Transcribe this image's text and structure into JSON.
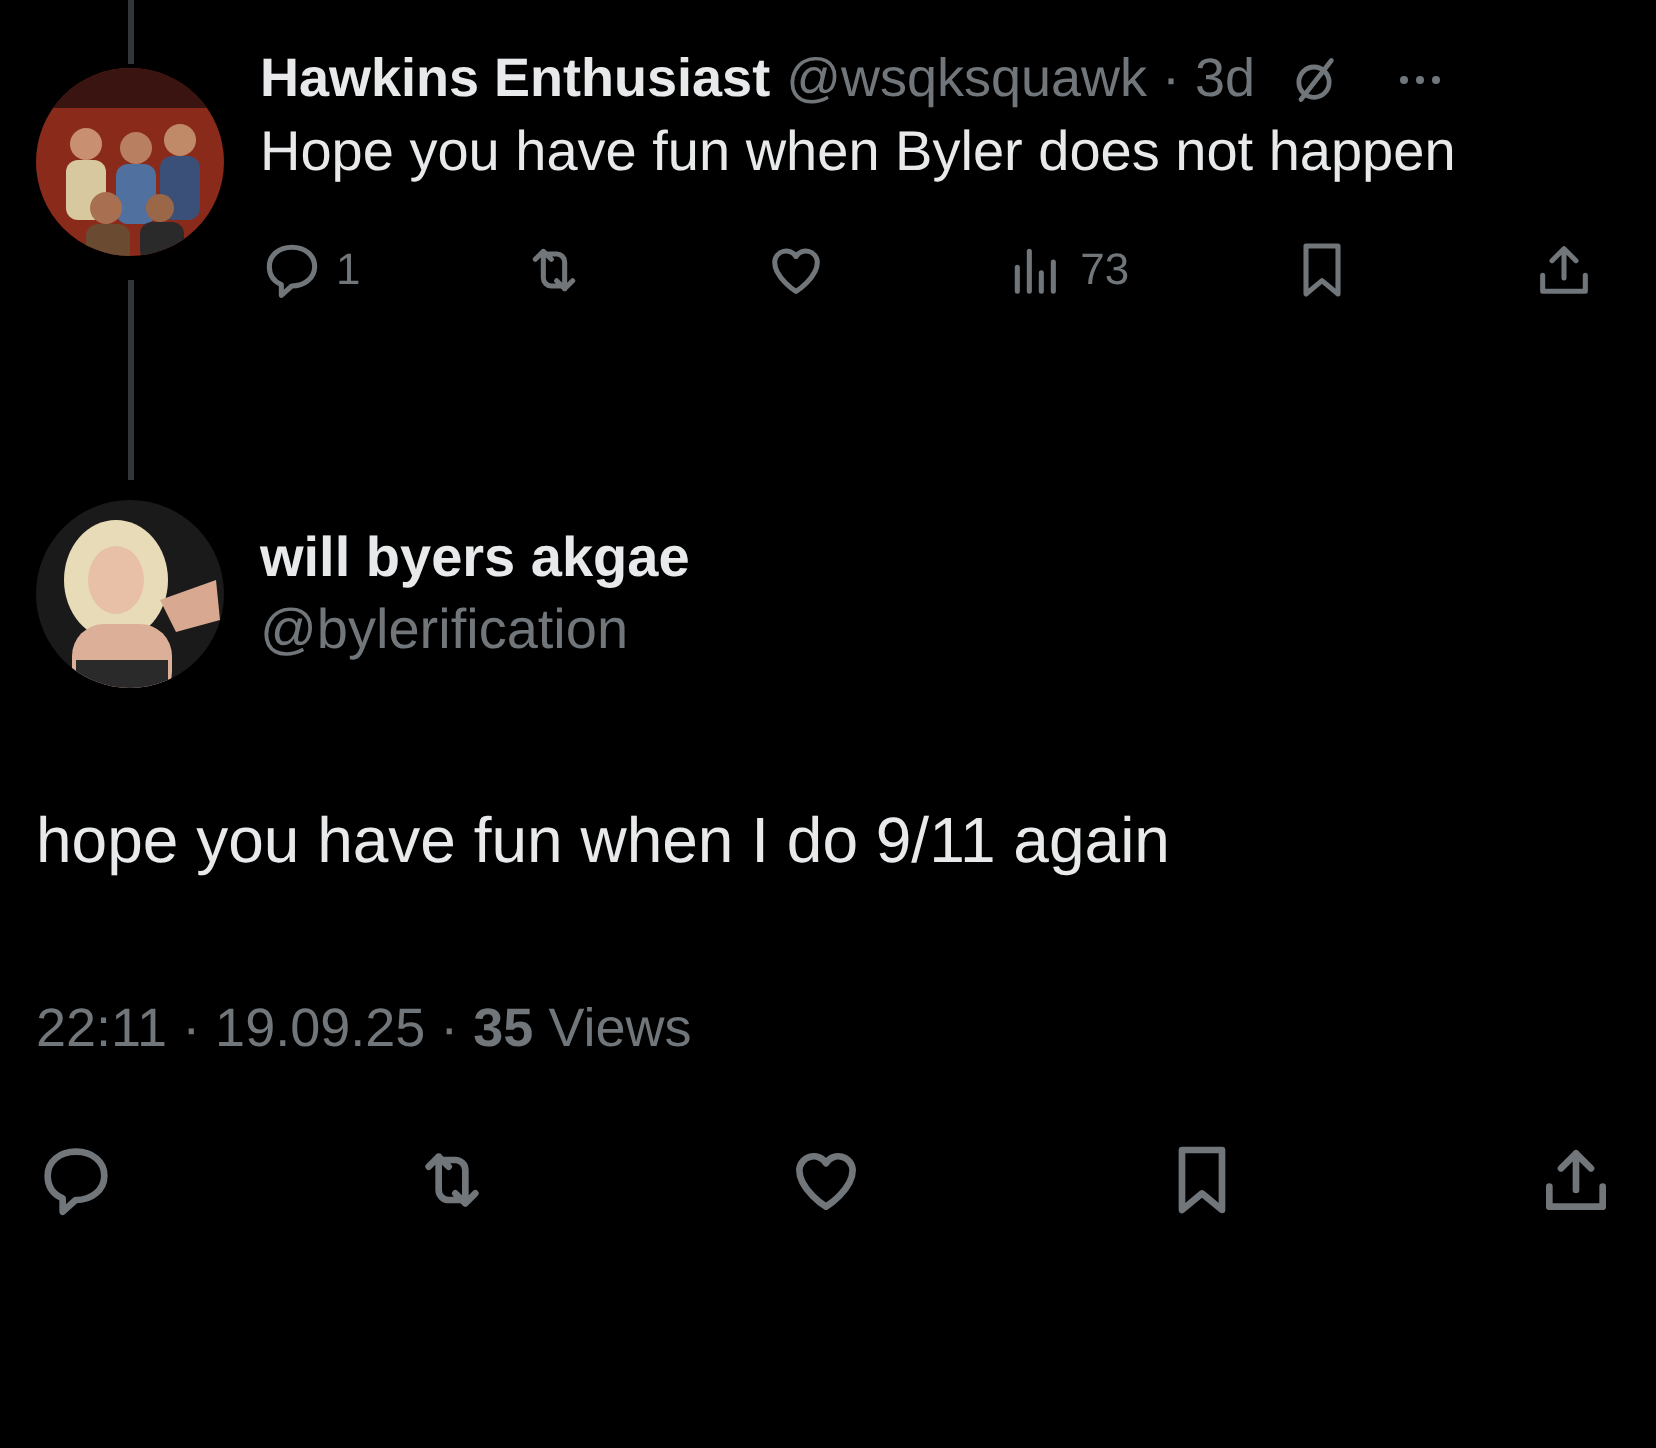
{
  "reply": {
    "author": {
      "name": "Hawkins Enthusiast",
      "handle_time": "@wsqksquawk · 3d"
    },
    "text": "Hope you have fun when Byler does not happen",
    "actions": [
      {
        "kind": "reply",
        "count": "1"
      },
      {
        "kind": "repost"
      },
      {
        "kind": "like"
      },
      {
        "kind": "views",
        "count": "73"
      },
      {
        "kind": "bookmark"
      },
      {
        "kind": "share"
      }
    ]
  },
  "tweet": {
    "author": {
      "name": "will byers akgae",
      "handle": "@bylerification"
    },
    "text": "hope you have fun when I do 9/11 again",
    "meta": "22:11 · 19.09.25 · **35** Views",
    "actions": [
      {
        "kind": "reply"
      },
      {
        "kind": "repost"
      },
      {
        "kind": "like"
      },
      {
        "kind": "bookmark"
      },
      {
        "kind": "share"
      }
    ]
  }
}
